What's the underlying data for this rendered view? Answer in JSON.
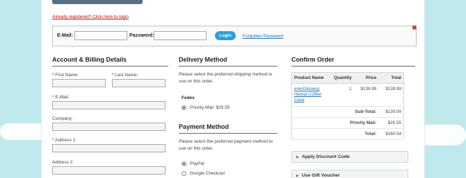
{
  "header": {
    "already_registered": "Already registered? Click here to login"
  },
  "login": {
    "email_label": "E-Mail:",
    "email_value": "",
    "password_label": "Password:",
    "password_value": "",
    "login_button": "Login",
    "forgot_password": "Forgotten Password",
    "close_icon": "close-icon"
  },
  "account": {
    "heading": "Account & Billing Details",
    "first_name": "First Name:",
    "last_name": "Last Name:",
    "email": "E-Mail:",
    "company": "Company:",
    "address1": "Address 1:",
    "address2": "Address 2:",
    "required_mark": "*"
  },
  "delivery": {
    "heading": "Delivery Method",
    "description": "Please select the preferred shipping method to use on this order.",
    "carrier": "Fedex",
    "options": [
      {
        "label": "Priority Mail",
        "price": "$20.55",
        "selected": true
      }
    ]
  },
  "payment": {
    "heading": "Payment Method",
    "description": "Please select the preferred payment method to use on this order.",
    "options": [
      {
        "label": "PayPal",
        "selected": true
      },
      {
        "label": "Google Checkout",
        "selected": false
      }
    ]
  },
  "order": {
    "heading": "Confirm Order",
    "columns": [
      "Product Name",
      "Quantity",
      "Price",
      "Total"
    ],
    "items": [
      {
        "name": "enerGinseng Herbal Coffee Case",
        "quantity": "1",
        "price": "$139.99",
        "total": "$139.99"
      }
    ],
    "totals": [
      {
        "label": "Sub-Total:",
        "value": "$139.99"
      },
      {
        "label": "Priority Mail:",
        "value": "$20.55"
      },
      {
        "label": "Total:",
        "value": "$160.54"
      }
    ],
    "discount_label": "Apply Discount Code",
    "voucher_label": "Use Gift Voucher"
  }
}
